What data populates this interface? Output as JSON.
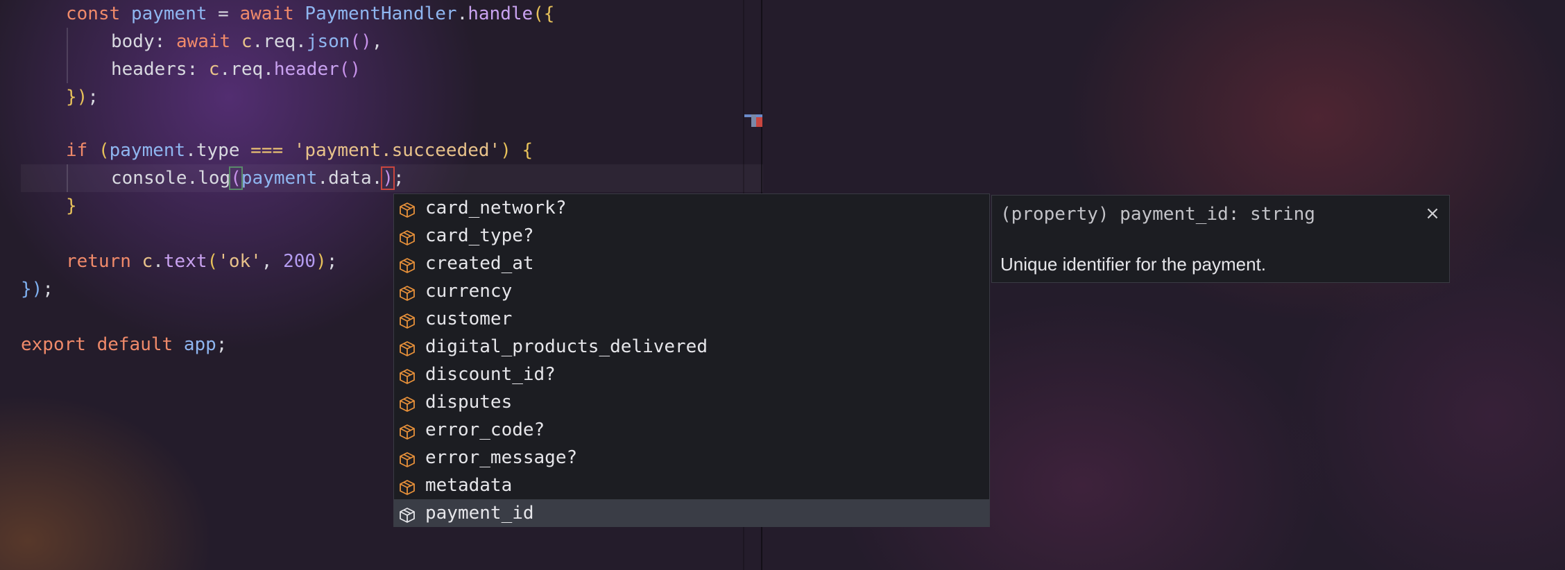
{
  "code": {
    "line1": {
      "kw": "const",
      "var": "payment",
      "op": "=",
      "await": "await",
      "cls": "PaymentHandler",
      "dot": ".",
      "fn": "handle",
      "open": "({"
    },
    "line2": {
      "prop": "body:",
      "await": "await",
      "obj": "c",
      "dot1": ".",
      "req": "req",
      "dot2": ".",
      "fn": "json",
      "paren": "()",
      "comma": ","
    },
    "line3": {
      "prop": "headers:",
      "obj": "c",
      "dot1": ".",
      "req": "req",
      "dot2": ".",
      "fn": "header",
      "paren": "()"
    },
    "line4": {
      "close": "})",
      "semi": ";"
    },
    "line6": {
      "kw": "if",
      "open": "(",
      "var": "payment",
      "rest": ".type",
      "op": "===",
      "str": "'payment.succeeded'",
      "close": ")",
      "brace": "{"
    },
    "line7": {
      "obj": "console",
      "dot": ".",
      "fn": "log",
      "open": "(",
      "var": "payment",
      "rest": ".data.",
      "close": ")",
      "semi": ";"
    },
    "line8": {
      "brace": "}"
    },
    "line10": {
      "kw": "return",
      "obj": "c",
      "dot": ".",
      "fn": "text",
      "open": "(",
      "str": "'ok'",
      "comma": ",",
      "num": "200",
      "close": ")",
      "semi": ";"
    },
    "line11": {
      "close": "})",
      "semi": ";"
    },
    "line13": {
      "kw1": "export",
      "kw2": "default",
      "var": "app",
      "semi": ";"
    }
  },
  "suggestions": [
    {
      "label": "card_network?",
      "icon": "property-icon"
    },
    {
      "label": "card_type?",
      "icon": "property-icon"
    },
    {
      "label": "created_at",
      "icon": "property-icon"
    },
    {
      "label": "currency",
      "icon": "property-icon"
    },
    {
      "label": "customer",
      "icon": "property-icon"
    },
    {
      "label": "digital_products_delivered",
      "icon": "property-icon"
    },
    {
      "label": "discount_id?",
      "icon": "property-icon"
    },
    {
      "label": "disputes",
      "icon": "property-icon"
    },
    {
      "label": "error_code?",
      "icon": "property-icon"
    },
    {
      "label": "error_message?",
      "icon": "property-icon"
    },
    {
      "label": "metadata",
      "icon": "property-icon"
    },
    {
      "label": "payment_id",
      "icon": "property-icon",
      "selected": true
    }
  ],
  "docs": {
    "signature": "(property) payment_id: string",
    "description": "Unique identifier for the payment.",
    "close_glyph": "×"
  },
  "colors": {
    "property_icon": "#e8913a",
    "selected_bg": "#3a3d46",
    "widget_bg": "#1c1d22"
  }
}
